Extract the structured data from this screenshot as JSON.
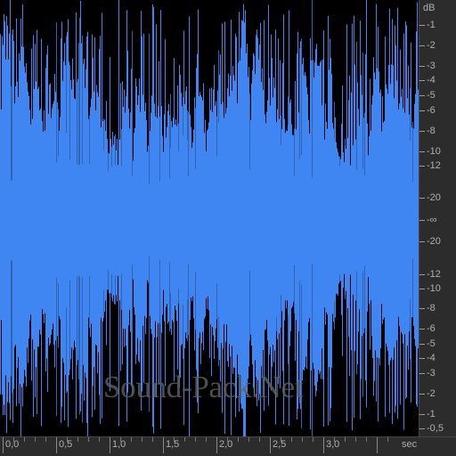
{
  "editor": {
    "type": "audio-waveform",
    "watermark": "Sound-Pack.Net",
    "colors": {
      "background": "#000000",
      "waveform": "#3f86f2",
      "ruler_background": "#2c2c2c",
      "ruler_text": "#b0b0b0"
    },
    "db_ruler": {
      "unit": "dB",
      "labels_top": [
        "-1",
        "-2",
        "-3",
        "-4",
        "-5",
        "-6",
        "-8",
        "-10",
        "-12",
        "-20"
      ],
      "center_label": "-∞",
      "labels_bottom": [
        "-20",
        "-12",
        "-10",
        "-8",
        "-6",
        "-5",
        "-4",
        "-3",
        "-2",
        "-1",
        "-0,5"
      ]
    },
    "time_ruler": {
      "unit": "sec",
      "labels": [
        "0,0",
        "0,5",
        "1,0",
        "1,5",
        "2,0",
        "2,5",
        "3,0"
      ],
      "values": [
        0.0,
        0.5,
        1.0,
        1.5,
        2.0,
        2.5,
        3.0
      ],
      "visible_duration": 3.75
    }
  }
}
